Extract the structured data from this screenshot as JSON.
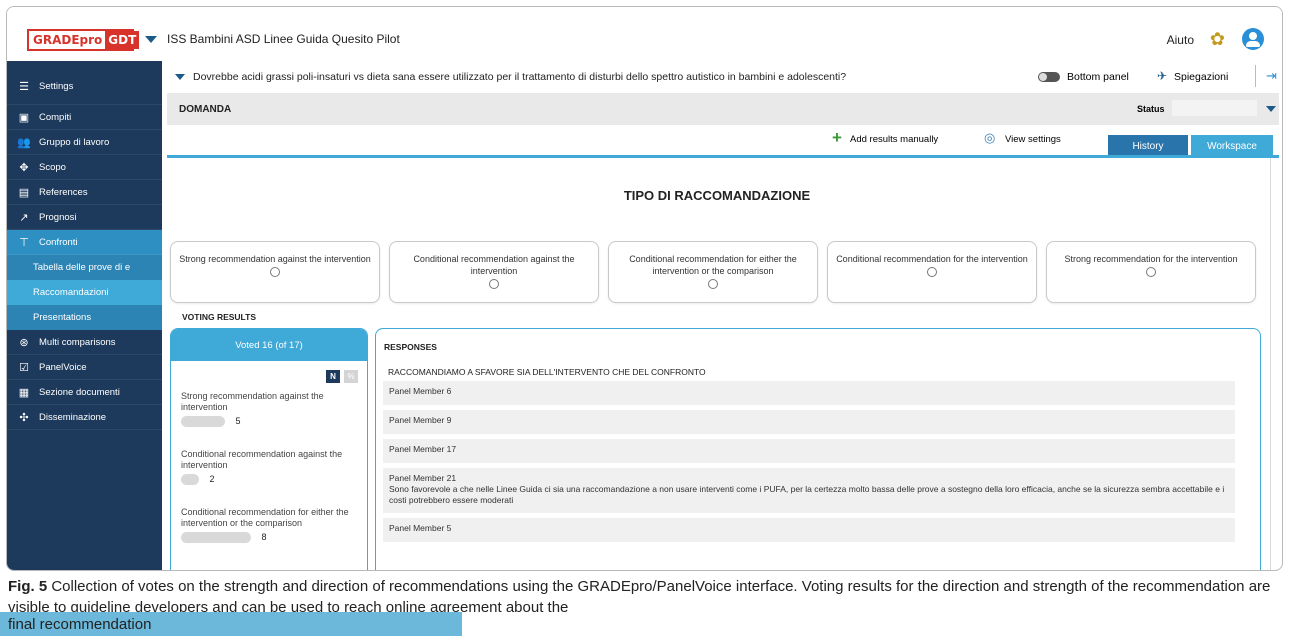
{
  "header": {
    "logo_text": "GRADEpro",
    "logo_box": "GDT",
    "project_title": "ISS Bambini ASD Linee Guida Quesito Pilot",
    "help": "Aiuto"
  },
  "sidebar": {
    "items": [
      {
        "label": "Settings",
        "icon": "sliders-icon"
      },
      {
        "label": "Compiti",
        "icon": "tasks-icon"
      },
      {
        "label": "Gruppo di lavoro",
        "icon": "team-icon"
      },
      {
        "label": "Scopo",
        "icon": "scope-icon"
      },
      {
        "label": "References",
        "icon": "references-icon"
      },
      {
        "label": "Prognosi",
        "icon": "prognosis-icon"
      },
      {
        "label": "Confronti",
        "icon": "comparisons-icon"
      }
    ],
    "subitems": [
      {
        "label": "Tabella delle prove di e"
      },
      {
        "label": "Raccomandazioni"
      },
      {
        "label": "Presentations"
      }
    ],
    "items_after": [
      {
        "label": "Multi comparisons",
        "icon": "multi-icon"
      },
      {
        "label": "PanelVoice",
        "icon": "panelvoice-icon"
      },
      {
        "label": "Sezione documenti",
        "icon": "document-icon"
      },
      {
        "label": "Disseminazione",
        "icon": "dissemination-icon"
      }
    ]
  },
  "question": {
    "text": "Dovrebbe acidi grassi poli-insaturi vs dieta sana essere utilizzato per il trattamento di disturbi dello spettro autistico in bambini e adolescenti?",
    "bottom_panel": "Bottom panel",
    "explanations": "Spiegazioni"
  },
  "domanda": {
    "label": "DOMANDA",
    "status_label": "Status"
  },
  "actions": {
    "add_results": "Add results manually",
    "view_settings": "View settings",
    "tab_history": "History",
    "tab_workspace": "Workspace"
  },
  "recommendation": {
    "title": "TIPO DI RACCOMANDAZIONE",
    "options": [
      "Strong recommendation against the intervention",
      "Conditional recommendation against the intervention",
      "Conditional recommendation for either the intervention or the comparison",
      "Conditional recommendation for the intervention",
      "Strong recommendation for the intervention"
    ]
  },
  "voting": {
    "section_label": "VOTING RESULTS",
    "header": "Voted 16 (of 17)",
    "badge_n": "N",
    "badge_pct": "%",
    "items": [
      {
        "label": "Strong recommendation against the intervention",
        "count": "5",
        "share": 0.3125
      },
      {
        "label": "Conditional recommendation against the intervention",
        "count": "2",
        "share": 0.125
      },
      {
        "label": "Conditional recommendation for either the intervention or the comparison",
        "count": "8",
        "share": 0.5
      }
    ]
  },
  "responses": {
    "header": "RESPONSES",
    "group_title": "RACCOMANDIAMO A SFAVORE SIA DELL'INTERVENTO CHE DEL CONFRONTO",
    "members": [
      {
        "name": "Panel Member 6",
        "comment": ""
      },
      {
        "name": "Panel Member 9",
        "comment": ""
      },
      {
        "name": "Panel Member 17",
        "comment": ""
      },
      {
        "name": "Panel Member 21",
        "comment": "Sono favorevole a che nelle Linee Guida ci sia una raccomandazione a non usare interventi come i PUFA, per la certezza molto bassa delle prove a sostegno della loro efficacia, anche se la sicurezza sembra accettabile e i costi potrebbero essere moderati"
      },
      {
        "name": "Panel Member 5",
        "comment": ""
      }
    ]
  },
  "caption": {
    "label": "Fig. 5",
    "text": "Collection of votes on the strength and direction of recommendations using the GRADEpro/PanelVoice interface. Voting results for the direction and strength of the recommendation are visible to guideline developers and can be used to reach online agreement about the",
    "last_line": "final recommendation"
  },
  "colors": {
    "sidebar": "#1d3a5c",
    "accent": "#3fa9d8",
    "logo": "#d8332b"
  }
}
